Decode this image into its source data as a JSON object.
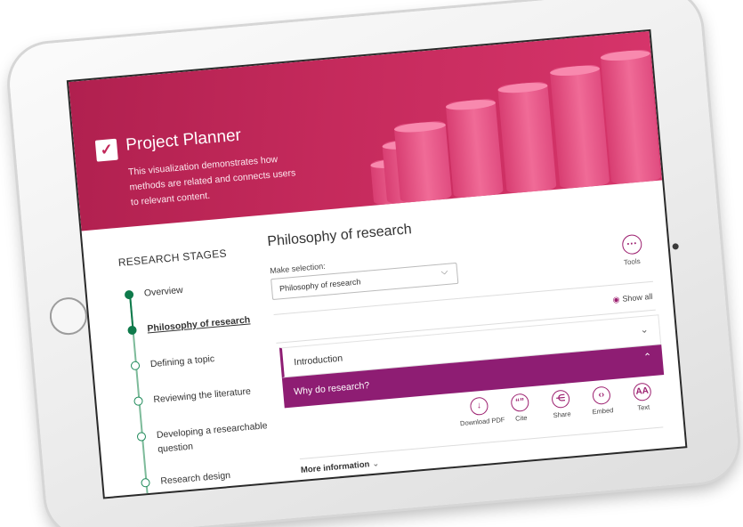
{
  "app": {
    "title": "Project Planner",
    "description": "This visualization demonstrates how methods are related and connects users to relevant content."
  },
  "sidebar": {
    "title": "RESEARCH STAGES",
    "items": [
      {
        "label": "Overview",
        "state": "done"
      },
      {
        "label": "Philosophy of research",
        "state": "active"
      },
      {
        "label": "Defining a topic",
        "state": "pending"
      },
      {
        "label": "Reviewing the literature",
        "state": "pending"
      },
      {
        "label": "Developing a researchable question",
        "state": "pending"
      },
      {
        "label": "Research design",
        "state": "pending"
      }
    ]
  },
  "main": {
    "title": "Philosophy of research",
    "selection_label": "Make selection:",
    "selection_value": "Philosophy of research",
    "tools_label": "Tools",
    "show_all_label": "Show all",
    "sections": [
      {
        "label": "Introduction",
        "expanded": false
      },
      {
        "label": "Why do research?",
        "expanded": true
      }
    ],
    "actions": [
      {
        "label": "Download PDF",
        "icon": "download-icon"
      },
      {
        "label": "Cite",
        "icon": "quote-icon"
      },
      {
        "label": "Share",
        "icon": "share-icon"
      },
      {
        "label": "Embed",
        "icon": "code-icon"
      },
      {
        "label": "Text",
        "icon": "text-size-icon"
      }
    ],
    "more_info_label": "More information"
  },
  "colors": {
    "hero": "#c2285a",
    "accent": "#8e1d73",
    "stage_green": "#0f7a4b"
  }
}
